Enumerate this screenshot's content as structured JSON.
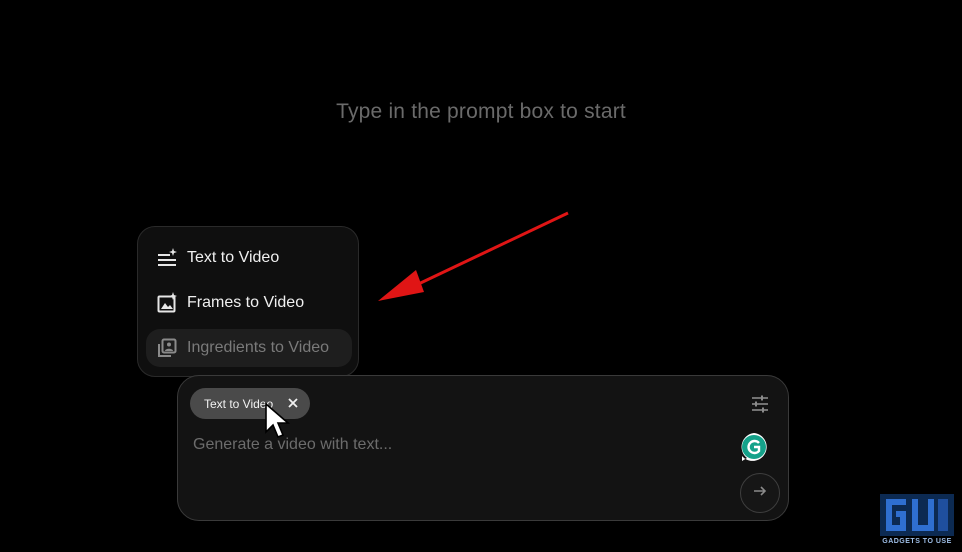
{
  "main": {
    "hint": "Type in the prompt box to start"
  },
  "mode_menu": {
    "items": [
      {
        "label": "Text to Video",
        "icon": "text-sparkle-icon",
        "selected": false
      },
      {
        "label": "Frames to Video",
        "icon": "image-sparkle-icon",
        "selected": false
      },
      {
        "label": "Ingredients to Video",
        "icon": "ingredients-icon",
        "selected": true
      }
    ]
  },
  "prompt_box": {
    "chip_label": "Text to Video",
    "chip_close_icon": "close-icon",
    "placeholder": "Generate a video with text...",
    "settings_icon": "sliders-icon",
    "grammarly_icon": "grammarly-icon",
    "send_icon": "arrow-right-icon"
  },
  "annotation": {
    "arrow_color": "#e01515"
  },
  "watermark": {
    "logo_icon": "gadgets-to-use-logo",
    "text": "GADGETS TO USE"
  }
}
